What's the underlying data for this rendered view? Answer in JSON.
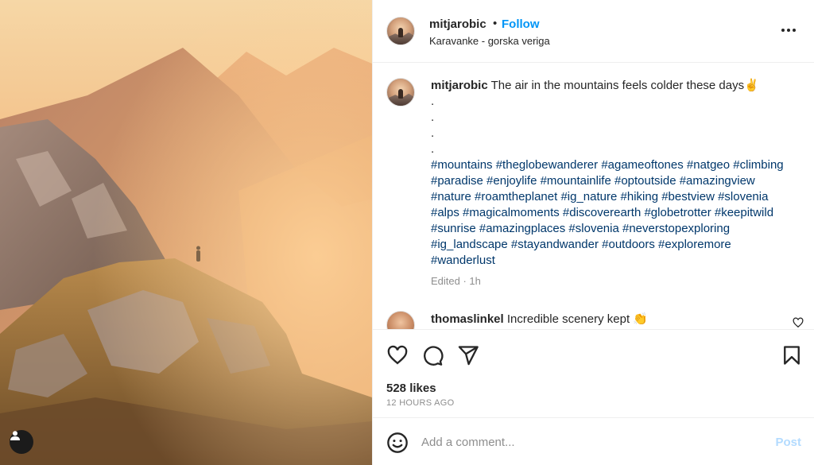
{
  "post": {
    "author": "mitjarobic",
    "separator": "•",
    "follow_label": "Follow",
    "location": "Karavanke - gorska veriga",
    "more_icon": "more-horizontal-icon",
    "photo_icon": "user-tag-icon"
  },
  "caption": {
    "author": "mitjarobic",
    "text": "The air in the mountains feels colder these days✌️",
    "dots": [
      ".",
      ".",
      ".",
      "."
    ],
    "hashtags": "#mountains #theglobewanderer #agameoftones #natgeo #climbing #paradise #enjoylife #mountainlife #optoutside #amazingview #nature #roamtheplanet #ig_nature #hiking #bestview #slovenia #alps #magicalmoments #discoverearth #globetrotter #keepitwild #sunrise #amazingplaces #slovenia  #neverstopexploring #ig_landscape #stayandwander #outdoors #exploremore #wanderlust",
    "edited": "Edited · 1h"
  },
  "comment": {
    "author": "thomaslinkel",
    "text": "Incredible scenery kept 👏"
  },
  "actions": {
    "likes": "528 likes",
    "time": "12 HOURS AGO"
  },
  "add_comment": {
    "placeholder": "Add a comment...",
    "post_label": "Post"
  },
  "colors": {
    "accent": "#0095f6",
    "hashtag": "#00376b",
    "muted": "#8e8e8e",
    "post_disabled": "#b3dbff"
  }
}
